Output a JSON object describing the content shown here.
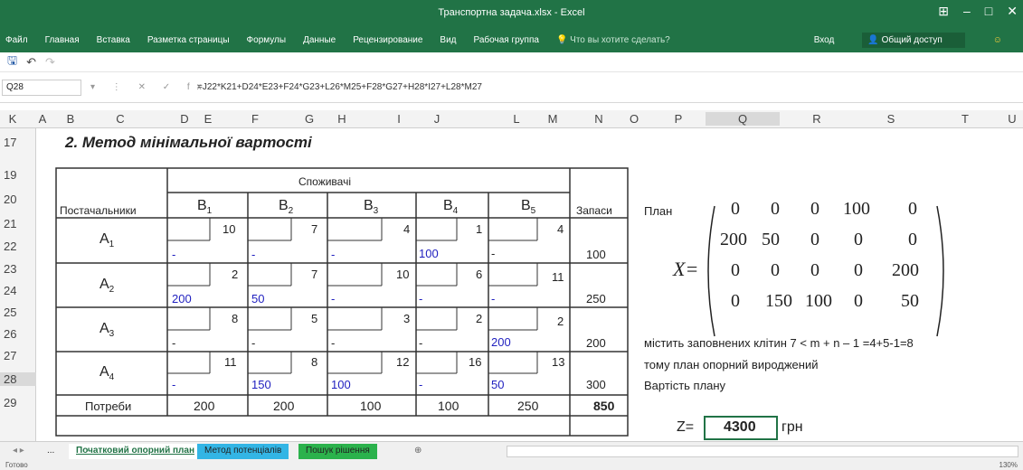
{
  "window": {
    "title": "Транспортна задача.xlsx - Excel"
  },
  "ribbon": {
    "tabs": [
      "Файл",
      "Главная",
      "Вставка",
      "Разметка страницы",
      "Формулы",
      "Данные",
      "Рецензирование",
      "Вид",
      "Рабочая группа"
    ],
    "tell_me": "Что вы хотите сделать?",
    "signin": "Вход",
    "share": "Общий доступ"
  },
  "formula_bar": {
    "cell": "Q28",
    "formula": "=J22*K21+D24*E23+F24*G23+L26*M25+F28*G27+H28*I27+L28*M27"
  },
  "columns": [
    "A",
    "B",
    "C",
    "D",
    "E",
    "F",
    "G",
    "H",
    "I",
    "J",
    "K",
    "L",
    "M",
    "N",
    "O",
    "P",
    "Q",
    "R",
    "S",
    "T",
    "U"
  ],
  "rows": [
    "17",
    "19",
    "20",
    "21",
    "22",
    "23",
    "24",
    "25",
    "26",
    "27",
    "28",
    "29"
  ],
  "sheet": {
    "heading": "2. Метод мінімальної вартості",
    "consumers": "Споживачі",
    "suppliers_header": "Постачальники",
    "stock_header": "Запаси",
    "b_headers": [
      "B",
      "B",
      "B",
      "B",
      "B"
    ],
    "b_subs": [
      "1",
      "2",
      "3",
      "4",
      "5"
    ],
    "a_labels": [
      "A",
      "A",
      "A",
      "A"
    ],
    "a_subs": [
      "1",
      "2",
      "3",
      "4"
    ],
    "costs": [
      [
        "10",
        "7",
        "4",
        "1",
        "4"
      ],
      [
        "2",
        "7",
        "10",
        "6",
        "11"
      ],
      [
        "8",
        "5",
        "3",
        "2",
        "2"
      ],
      [
        "11",
        "8",
        "12",
        "16",
        "13"
      ]
    ],
    "alloc": [
      [
        "-",
        "-",
        "-",
        "100",
        "-"
      ],
      [
        "200",
        "50",
        "-",
        "-",
        "-"
      ],
      [
        "-",
        "-",
        "-",
        "-",
        "200"
      ],
      [
        "-",
        "150",
        "100",
        "-",
        "50"
      ]
    ],
    "stocks": [
      "100",
      "250",
      "200",
      "300"
    ],
    "demand_label": "Потреби",
    "demands": [
      "200",
      "200",
      "100",
      "100",
      "250"
    ],
    "total": "850",
    "plan_label": "План",
    "x_label": "X=",
    "matrix": [
      [
        "0",
        "0",
        "0",
        "100",
        "0"
      ],
      [
        "200",
        "50",
        "0",
        "0",
        "0"
      ],
      [
        "0",
        "0",
        "0",
        "0",
        "200"
      ],
      [
        "0",
        "150",
        "100",
        "0",
        "50"
      ]
    ],
    "note1": "містить заповнених клітин 7 < m + n – 1 =4+5-1=8",
    "note2": "тому план опорний вироджений",
    "cost_label": "Вартість плану",
    "z_label": "Z=",
    "z_value": "4300",
    "z_unit": "грн"
  },
  "tabs": {
    "ellipsis": "...",
    "t1": "Початковий опорний план",
    "t2": "Метод потенціалів",
    "t3": "Пошук рішення",
    "t1_color": "#ffffff",
    "t2_color": "#33b5e5",
    "t3_color": "#2bb24c"
  },
  "status": {
    "ready": "Готово",
    "zoom": "130%"
  }
}
